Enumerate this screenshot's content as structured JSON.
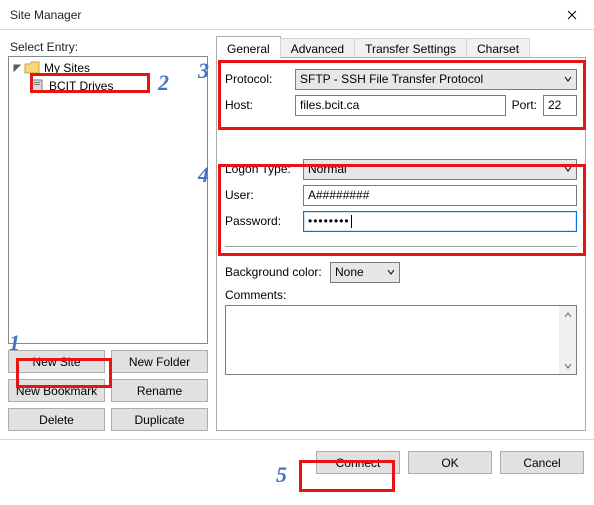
{
  "title": "Site Manager",
  "left": {
    "label": "Select Entry:",
    "tree": {
      "root": "My Sites",
      "item": "BCIT Drives"
    },
    "buttons": {
      "new_site": "New Site",
      "new_folder": "New Folder",
      "new_bookmark": "New Bookmark",
      "rename": "Rename",
      "delete": "Delete",
      "duplicate": "Duplicate"
    }
  },
  "tabs": {
    "general": "General",
    "advanced": "Advanced",
    "transfer": "Transfer Settings",
    "charset": "Charset"
  },
  "general": {
    "protocol_label": "Protocol:",
    "protocol_value": "SFTP - SSH File Transfer Protocol",
    "host_label": "Host:",
    "host_value": "files.bcit.ca",
    "port_label": "Port:",
    "port_value": "22",
    "logon_label": "Logon Type:",
    "logon_value": "Normal",
    "user_label": "User:",
    "user_value": "A########",
    "password_label": "Password:",
    "password_value": "••••••••",
    "bgcolor_label": "Background color:",
    "bgcolor_value": "None",
    "comments_label": "Comments:"
  },
  "footer": {
    "connect": "Connect",
    "ok": "OK",
    "cancel": "Cancel"
  },
  "annotations": {
    "n1": "1",
    "n2": "2",
    "n3": "3",
    "n4": "4",
    "n5": "5"
  }
}
